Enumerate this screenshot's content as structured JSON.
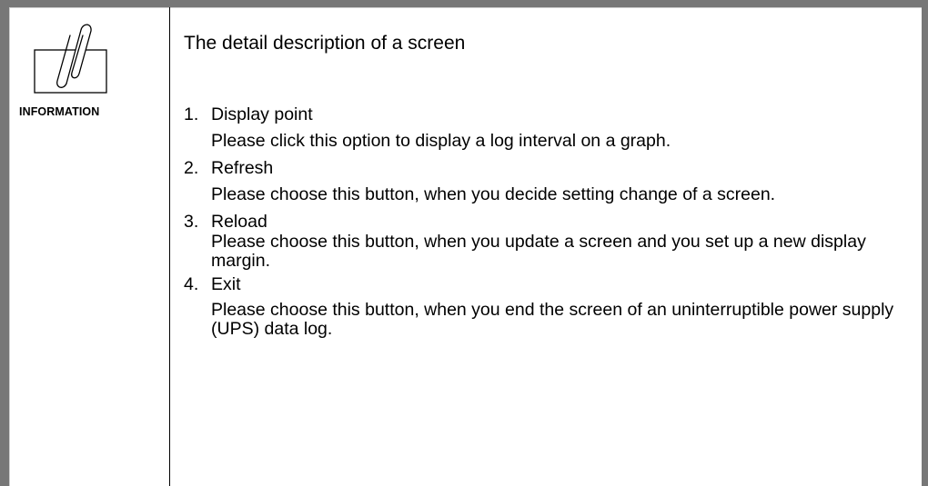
{
  "sidebar": {
    "icon": "paperclip-note-icon",
    "label": "INFORMATION"
  },
  "main": {
    "heading": "The detail description of a screen",
    "items": [
      {
        "number": "1.",
        "title": "Display point",
        "description": "Please click this option to display a log interval on a graph."
      },
      {
        "number": "2.",
        "title": "Refresh",
        "description": "Please choose this button, when you decide setting change of a screen."
      },
      {
        "number": "3.",
        "title": "Reload",
        "description": "Please choose this button, when you update a screen and you set up a new display margin."
      },
      {
        "number": "4.",
        "title": "Exit",
        "description": "Please choose this button, when you end the screen of an uninterruptible power supply (UPS) data log."
      }
    ]
  },
  "colors": {
    "frame": "#777777",
    "text": "#000000",
    "background": "#ffffff"
  }
}
